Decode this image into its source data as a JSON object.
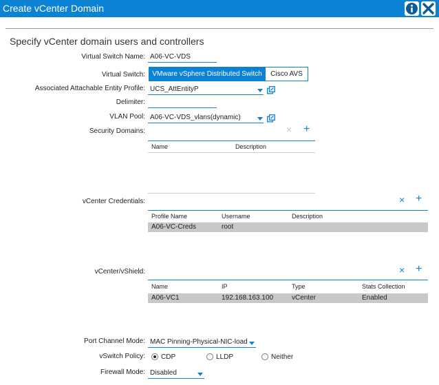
{
  "window": {
    "title": "Create vCenter Domain",
    "info_icon": "info-icon",
    "close_icon": "close-icon"
  },
  "form": {
    "heading": "Specify vCenter domain users and controllers",
    "virtual_switch_name": {
      "label": "Virtual Switch Name:",
      "value": "A06-VC-VDS"
    },
    "virtual_switch": {
      "label": "Virtual Switch:",
      "options": [
        "VMware vSphere Distributed Switch",
        "Cisco AVS"
      ],
      "selected": "VMware vSphere Distributed Switch"
    },
    "aaep": {
      "label": "Associated Attachable Entity Profile:",
      "value": "UCS_AttEntityP"
    },
    "delimiter": {
      "label": "Delimiter:",
      "value": ""
    },
    "vlan_pool": {
      "label": "VLAN Pool:",
      "value": "A06-VC-VDS_vlans(dynamic)"
    },
    "security_domains": {
      "label": "Security Domains:",
      "columns": [
        "Name",
        "Description"
      ],
      "rows": []
    },
    "vcenter_credentials": {
      "label": "vCenter Credentials:",
      "columns": [
        "Profile Name",
        "Username",
        "Description"
      ],
      "rows": [
        [
          "A06-VC-Creds",
          "root",
          ""
        ]
      ]
    },
    "vcenter_vshield": {
      "label": "vCenter/vShield:",
      "columns": [
        "Name",
        "IP",
        "Type",
        "Stats Collection"
      ],
      "rows": [
        [
          "A06-VC1",
          "192.168.163.100",
          "vCenter",
          "Enabled"
        ]
      ]
    },
    "port_channel_mode": {
      "label": "Port Channel Mode:",
      "value": "MAC Pinning-Physical-NIC-load"
    },
    "vswitch_policy": {
      "label": "vSwitch Policy:",
      "options": [
        "CDP",
        "LLDP",
        "Neither"
      ],
      "selected": "CDP"
    },
    "firewall_mode": {
      "label": "Firewall Mode:",
      "value": "Disabled"
    }
  },
  "colors": {
    "accent": "#0b82d4",
    "selected_row": "#c8c8c8"
  }
}
